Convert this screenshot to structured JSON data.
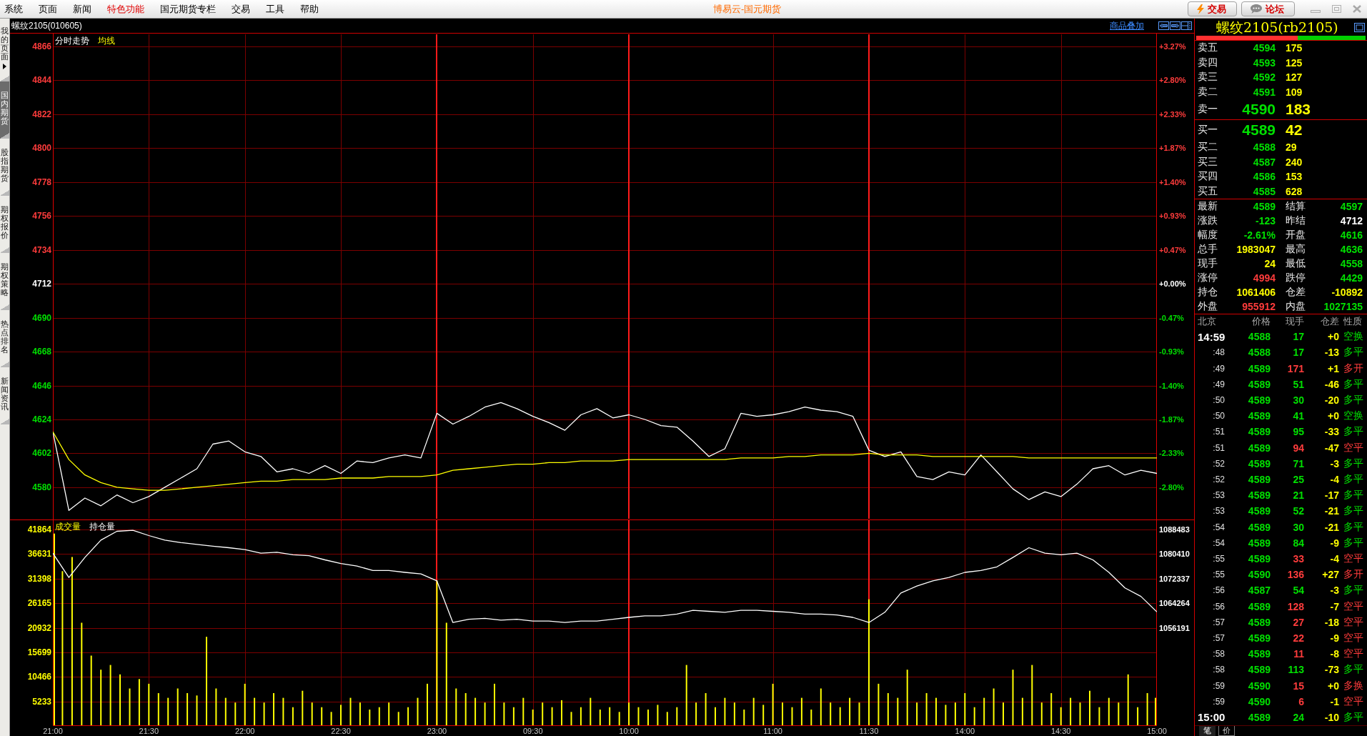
{
  "menu_bar": {
    "items": [
      {
        "label": "系统",
        "highlighted": false
      },
      {
        "label": "页面",
        "highlighted": false
      },
      {
        "label": "新闻",
        "highlighted": false
      },
      {
        "label": "特色功能",
        "highlighted": true
      },
      {
        "label": "国元期货专栏",
        "highlighted": false
      },
      {
        "label": "交易",
        "highlighted": false
      },
      {
        "label": "工具",
        "highlighted": false
      },
      {
        "label": "帮助",
        "highlighted": false
      }
    ],
    "title": "博易云-国元期货",
    "buttons": [
      {
        "label": "交易",
        "kind": "bolt"
      },
      {
        "label": "论坛",
        "kind": "chat"
      }
    ]
  },
  "side_tabs": [
    {
      "label": "我的页面",
      "selected": false,
      "submenu": true
    },
    {
      "label": "国内期货",
      "selected": true,
      "submenu": false
    },
    {
      "label": "股指期货",
      "selected": false,
      "submenu": false
    },
    {
      "label": "期权报价",
      "selected": false,
      "submenu": false
    },
    {
      "label": "期权策略",
      "selected": false,
      "submenu": false
    },
    {
      "label": "热点排名",
      "selected": false,
      "submenu": false
    },
    {
      "label": "新闻资讯",
      "selected": false,
      "submenu": false
    }
  ],
  "chart_header": {
    "title": "螺纹2105(010605)",
    "overlay_link": "商品叠加"
  },
  "price_panel": {
    "chart_data": {
      "type": "line",
      "categories": [
        null,
        null,
        null,
        null,
        null,
        null,
        null,
        null,
        null,
        null,
        null,
        null,
        null,
        null,
        null,
        null,
        null,
        null,
        null,
        null,
        null,
        null,
        null,
        null,
        null,
        null,
        null,
        null,
        null,
        null,
        null,
        null,
        null,
        null,
        null,
        null,
        null,
        null,
        null,
        null,
        null,
        null,
        null,
        null,
        null,
        null,
        null,
        null,
        null,
        null,
        null,
        null,
        null,
        null,
        null,
        null,
        null,
        null,
        null,
        null,
        null,
        null,
        null,
        null,
        null,
        null,
        null,
        null,
        null,
        null
      ],
      "ylim": [
        4559.1,
        4874.3
      ],
      "yticks": [
        4866,
        4844,
        4822,
        4800,
        4778,
        4756,
        4734,
        4712,
        4690,
        4668,
        4646,
        4624,
        4602,
        4580
      ],
      "grid": true,
      "series": [
        {
          "name": "分时走势",
          "color": "#ffffff",
          "values": [
            4616,
            4565,
            4573,
            4568,
            4575,
            4570,
            4574,
            4580,
            4586,
            4592,
            4608,
            4610,
            4603,
            4600,
            4590,
            4592,
            4589,
            4594,
            4589,
            4597,
            4596,
            4599,
            4601,
            4599,
            4628,
            4621,
            4626,
            4632,
            4635,
            4631,
            4626,
            4622,
            4617,
            4627,
            4631,
            4625,
            4627,
            4624,
            4620,
            4619,
            4610,
            4600,
            4605,
            4628,
            4626,
            4627,
            4629,
            4632,
            4630,
            4629,
            4626,
            4604,
            4600,
            4603,
            4587,
            4585,
            4590,
            4588,
            4601,
            4590,
            4579,
            4572,
            4577,
            4574,
            4582,
            4592,
            4594,
            4588,
            4591,
            4589
          ]
        },
        {
          "name": "均线",
          "color": "#ffff00",
          "values": [
            4616,
            4598,
            4588,
            4583,
            4580,
            4579,
            4578,
            4578,
            4579,
            4580,
            4581,
            4582,
            4583,
            4584,
            4584,
            4585,
            4585,
            4585,
            4586,
            4586,
            4586,
            4587,
            4587,
            4587,
            4588,
            4591,
            4592,
            4593,
            4594,
            4595,
            4595,
            4596,
            4596,
            4597,
            4597,
            4597,
            4598,
            4598,
            4598,
            4598,
            4598,
            4598,
            4598,
            4599,
            4599,
            4599,
            4600,
            4600,
            4601,
            4601,
            4601,
            4602,
            4601,
            4601,
            4601,
            4600,
            4600,
            4600,
            4600,
            4600,
            4600,
            4599,
            4599,
            4599,
            4599,
            4599,
            4599,
            4599,
            4599,
            4599
          ]
        }
      ]
    },
    "right_axis_labels": [
      {
        "label": "+3.27%",
        "color": "#ff3c3c"
      },
      {
        "label": "+2.80%",
        "color": "#ff3c3c"
      },
      {
        "label": "+2.33%",
        "color": "#ff3c3c"
      },
      {
        "label": "+1.87%",
        "color": "#ff3c3c"
      },
      {
        "label": "+1.40%",
        "color": "#ff3c3c"
      },
      {
        "label": "+0.93%",
        "color": "#ff3c3c"
      },
      {
        "label": "+0.47%",
        "color": "#ff3c3c"
      },
      {
        "label": "+0.00%",
        "color": "#ffffff"
      },
      {
        "label": "-0.47%",
        "color": "#00e000"
      },
      {
        "label": "-0.93%",
        "color": "#00e000"
      },
      {
        "label": "-1.40%",
        "color": "#00e000"
      },
      {
        "label": "-1.87%",
        "color": "#00e000"
      },
      {
        "label": "-2.33%",
        "color": "#00e000"
      },
      {
        "label": "-2.80%",
        "color": "#00e000"
      }
    ]
  },
  "volume_panel": {
    "volume": {
      "chart_data": {
        "type": "bar",
        "categories": [
          "21:00",
          null,
          null,
          null,
          null,
          null,
          null,
          null,
          null,
          null,
          "21:30",
          null,
          null,
          null,
          null,
          null,
          null,
          null,
          null,
          null,
          "22:00",
          null,
          null,
          null,
          null,
          null,
          null,
          null,
          null,
          null,
          "22:30",
          null,
          null,
          null,
          null,
          null,
          null,
          null,
          null,
          null,
          "23:00",
          null,
          null,
          null,
          null,
          null,
          null,
          null,
          null,
          null,
          "09:30",
          null,
          null,
          null,
          null,
          null,
          null,
          null,
          null,
          null,
          "10:00",
          null,
          null,
          null,
          null,
          null,
          null,
          null,
          null,
          null,
          null,
          null,
          null,
          null,
          null,
          "11:00",
          null,
          null,
          null,
          null,
          null,
          null,
          null,
          null,
          null,
          "11:30",
          null,
          null,
          null,
          null,
          null,
          null,
          null,
          null,
          null,
          "14:00",
          null,
          null,
          null,
          null,
          null,
          null,
          null,
          null,
          null,
          "14:30",
          null,
          null,
          null,
          null,
          null,
          null,
          null,
          null,
          null,
          "15:00"
        ],
        "ylim": [
          0,
          44000
        ],
        "yticks": [
          41864,
          36631,
          31398,
          26165,
          20932,
          15699,
          10466,
          5233
        ],
        "grid": true,
        "ref_lines": [
          {
            "axis": "x",
            "value": "23:00"
          },
          {
            "axis": "x",
            "value": "10:00"
          },
          {
            "axis": "x",
            "value": "11:30"
          }
        ],
        "series": [
          {
            "name": "成交量",
            "color": "#ffff00",
            "values": [
              41000,
              33000,
              36000,
              22000,
              15000,
              12000,
              13000,
              11000,
              8000,
              10000,
              9000,
              7000,
              6000,
              8000,
              7000,
              6500,
              19000,
              8000,
              6000,
              5000,
              9000,
              6000,
              5000,
              7000,
              6000,
              4000,
              7500,
              5000,
              4000,
              3000,
              4500,
              6000,
              5000,
              3500,
              4000,
              5000,
              3000,
              4000,
              6000,
              9000,
              31000,
              22000,
              8000,
              7000,
              6000,
              5000,
              9000,
              5000,
              4000,
              6000,
              3500,
              5000,
              4000,
              5500,
              3000,
              4000,
              6000,
              3500,
              4000,
              3000,
              5000,
              4000,
              3500,
              4500,
              3000,
              4000,
              13000,
              5000,
              7000,
              4000,
              6000,
              5000,
              3500,
              6000,
              4500,
              9000,
              5000,
              4000,
              6000,
              3500,
              8000,
              5000,
              4000,
              6000,
              5000,
              27000,
              9000,
              7000,
              6000,
              12000,
              5000,
              7000,
              6000,
              4500,
              5000,
              7000,
              4000,
              6000,
              8000,
              5000,
              12000,
              6000,
              13000,
              5000,
              7000,
              4000,
              6000,
              5000,
              7500,
              4000,
              6000,
              5000,
              11000,
              4000,
              7000,
              6000
            ]
          }
        ]
      }
    },
    "open_interest": {
      "chart_data": {
        "type": "line",
        "categories": [
          null,
          null,
          null,
          null,
          null,
          null,
          null,
          null,
          null,
          null,
          null,
          null,
          null,
          null,
          null,
          null,
          null,
          null,
          null,
          null,
          null,
          null,
          null,
          null,
          null,
          null,
          null,
          null,
          null,
          null,
          null,
          null,
          null,
          null,
          null,
          null,
          null,
          null,
          null,
          null,
          null,
          null,
          null,
          null,
          null,
          null,
          null,
          null,
          null,
          null,
          null,
          null,
          null,
          null,
          null,
          null,
          null,
          null,
          null,
          null,
          null,
          null,
          null,
          null,
          null,
          null,
          null,
          null,
          null,
          null
        ],
        "ylim": [
          1023900,
          1091780
        ],
        "yticks": [
          1088483,
          1080410,
          1072337,
          1064264,
          1056191
        ],
        "series": [
          {
            "name": "持仓量",
            "color": "#ffffff",
            "values": [
              1080700,
              1072700,
              1079300,
              1085000,
              1087900,
              1088200,
              1086500,
              1085000,
              1084200,
              1083600,
              1083000,
              1082500,
              1081900,
              1080700,
              1081000,
              1080200,
              1079900,
              1078500,
              1077300,
              1076500,
              1075000,
              1075000,
              1074400,
              1073900,
              1071600,
              1057900,
              1059000,
              1059300,
              1058700,
              1059000,
              1058400,
              1058400,
              1057900,
              1058400,
              1058400,
              1059000,
              1059600,
              1060100,
              1060100,
              1060700,
              1061900,
              1061600,
              1061300,
              1061900,
              1061900,
              1061600,
              1061300,
              1060700,
              1060700,
              1060400,
              1059600,
              1057900,
              1061300,
              1067600,
              1069900,
              1071600,
              1072700,
              1074400,
              1075000,
              1076200,
              1079300,
              1082500,
              1080700,
              1080200,
              1080700,
              1078500,
              1074400,
              1069300,
              1066500,
              1061400
            ]
          }
        ]
      }
    }
  },
  "quote_panel": {
    "title": "螺纹2105(rb2105)",
    "ratio_bar": {
      "level": 0.6
    },
    "asks": [
      {
        "label": "卖五",
        "price": "4594",
        "volume": "175",
        "kind": "depth"
      },
      {
        "label": "卖四",
        "price": "4593",
        "volume": "125",
        "kind": "depth"
      },
      {
        "label": "卖三",
        "price": "4592",
        "volume": "127",
        "kind": "depth"
      },
      {
        "label": "卖二",
        "price": "4591",
        "volume": "109",
        "kind": "depth"
      },
      {
        "label": "卖一",
        "price": "4590",
        "volume": "183",
        "kind": "best"
      }
    ],
    "bids": [
      {
        "label": "买一",
        "price": "4589",
        "volume": "42",
        "kind": "best"
      },
      {
        "label": "买二",
        "price": "4588",
        "volume": "29",
        "kind": "depth"
      },
      {
        "label": "买三",
        "price": "4587",
        "volume": "240",
        "kind": "depth"
      },
      {
        "label": "买四",
        "price": "4586",
        "volume": "153",
        "kind": "depth"
      },
      {
        "label": "买五",
        "price": "4585",
        "volume": "628",
        "kind": "depth"
      }
    ],
    "stats": [
      {
        "label": "最新",
        "value": "4589",
        "color": "#00e000"
      },
      {
        "label": "结算",
        "value": "4597",
        "color": "#00e000"
      },
      {
        "label": "涨跌",
        "value": "-123",
        "color": "#00e000"
      },
      {
        "label": "昨结",
        "value": "4712",
        "color": "#ffffff"
      },
      {
        "label": "幅度",
        "value": "-2.61%",
        "color": "#00e000"
      },
      {
        "label": "开盘",
        "value": "4616",
        "color": "#00e000"
      },
      {
        "label": "总手",
        "value": "1983047",
        "color": "#ffff00"
      },
      {
        "label": "最高",
        "value": "4636",
        "color": "#00e000"
      },
      {
        "label": "现手",
        "value": "24",
        "color": "#ffff00"
      },
      {
        "label": "最低",
        "value": "4558",
        "color": "#00e000"
      },
      {
        "label": "涨停",
        "value": "4994",
        "color": "#ff3c3c"
      },
      {
        "label": "跌停",
        "value": "4429",
        "color": "#00e000"
      },
      {
        "label": "持仓",
        "value": "1061406",
        "color": "#ffff00"
      },
      {
        "label": "仓差",
        "value": "-10892",
        "color": "#ffff00"
      },
      {
        "label": "外盘",
        "value": "955912",
        "color": "#ff3c3c"
      },
      {
        "label": "内盘",
        "value": "1027135",
        "color": "#00e000"
      }
    ],
    "trades": {
      "columns": [
        "北京",
        "价格",
        "现手",
        "仓差",
        "性质"
      ],
      "rows": [
        {
          "kind": "minute",
          "time": "14:59",
          "price": "4588",
          "volume": "17",
          "oi_change": "+0",
          "nature": "空换",
          "color": "#00e000"
        },
        {
          "kind": "second",
          "time": ":48",
          "price": "4588",
          "volume": "17",
          "oi_change": "-13",
          "nature": "多平",
          "color": "#00e000"
        },
        {
          "kind": "second",
          "time": ":49",
          "price": "4589",
          "volume": "171",
          "oi_change": "+1",
          "nature": "多开",
          "color": "#ff3c3c"
        },
        {
          "kind": "second",
          "time": ":49",
          "price": "4589",
          "volume": "51",
          "oi_change": "-46",
          "nature": "多平",
          "color": "#00e000"
        },
        {
          "kind": "second",
          "time": ":50",
          "price": "4589",
          "volume": "30",
          "oi_change": "-20",
          "nature": "多平",
          "color": "#00e000"
        },
        {
          "kind": "second",
          "time": ":50",
          "price": "4589",
          "volume": "41",
          "oi_change": "+0",
          "nature": "空换",
          "color": "#00e000"
        },
        {
          "kind": "second",
          "time": ":51",
          "price": "4589",
          "volume": "95",
          "oi_change": "-33",
          "nature": "多平",
          "color": "#00e000"
        },
        {
          "kind": "second",
          "time": ":51",
          "price": "4589",
          "volume": "94",
          "oi_change": "-47",
          "nature": "空平",
          "color": "#ff3c3c"
        },
        {
          "kind": "second",
          "time": ":52",
          "price": "4589",
          "volume": "71",
          "oi_change": "-3",
          "nature": "多平",
          "color": "#00e000"
        },
        {
          "kind": "second",
          "time": ":52",
          "price": "4589",
          "volume": "25",
          "oi_change": "-4",
          "nature": "多平",
          "color": "#00e000"
        },
        {
          "kind": "second",
          "time": ":53",
          "price": "4589",
          "volume": "21",
          "oi_change": "-17",
          "nature": "多平",
          "color": "#00e000"
        },
        {
          "kind": "second",
          "time": ":53",
          "price": "4589",
          "volume": "52",
          "oi_change": "-21",
          "nature": "多平",
          "color": "#00e000"
        },
        {
          "kind": "second",
          "time": ":54",
          "price": "4589",
          "volume": "30",
          "oi_change": "-21",
          "nature": "多平",
          "color": "#00e000"
        },
        {
          "kind": "second",
          "time": ":54",
          "price": "4589",
          "volume": "84",
          "oi_change": "-9",
          "nature": "多平",
          "color": "#00e000"
        },
        {
          "kind": "second",
          "time": ":55",
          "price": "4589",
          "volume": "33",
          "oi_change": "-4",
          "nature": "空平",
          "color": "#ff3c3c"
        },
        {
          "kind": "second",
          "time": ":55",
          "price": "4590",
          "volume": "136",
          "oi_change": "+27",
          "nature": "多开",
          "color": "#ff3c3c"
        },
        {
          "kind": "second",
          "time": ":56",
          "price": "4587",
          "volume": "54",
          "oi_change": "-3",
          "nature": "多平",
          "color": "#00e000"
        },
        {
          "kind": "second",
          "time": ":56",
          "price": "4589",
          "volume": "128",
          "oi_change": "-7",
          "nature": "空平",
          "color": "#ff3c3c"
        },
        {
          "kind": "second",
          "time": ":57",
          "price": "4589",
          "volume": "27",
          "oi_change": "-18",
          "nature": "空平",
          "color": "#ff3c3c"
        },
        {
          "kind": "second",
          "time": ":57",
          "price": "4589",
          "volume": "22",
          "oi_change": "-9",
          "nature": "空平",
          "color": "#ff3c3c"
        },
        {
          "kind": "second",
          "time": ":58",
          "price": "4589",
          "volume": "11",
          "oi_change": "-8",
          "nature": "空平",
          "color": "#ff3c3c"
        },
        {
          "kind": "second",
          "time": ":58",
          "price": "4589",
          "volume": "113",
          "oi_change": "-73",
          "nature": "多平",
          "color": "#00e000"
        },
        {
          "kind": "second",
          "time": ":59",
          "price": "4590",
          "volume": "15",
          "oi_change": "+0",
          "nature": "多换",
          "color": "#ff3c3c"
        },
        {
          "kind": "second",
          "time": ":59",
          "price": "4590",
          "volume": "6",
          "oi_change": "-1",
          "nature": "空平",
          "color": "#ff3c3c"
        },
        {
          "kind": "minute",
          "time": "15:00",
          "price": "4589",
          "volume": "24",
          "oi_change": "-10",
          "nature": "多平",
          "color": "#00e000"
        }
      ]
    },
    "bottom_tabs": [
      {
        "label": "笔",
        "selected": true
      },
      {
        "label": "价",
        "selected": false
      }
    ]
  }
}
